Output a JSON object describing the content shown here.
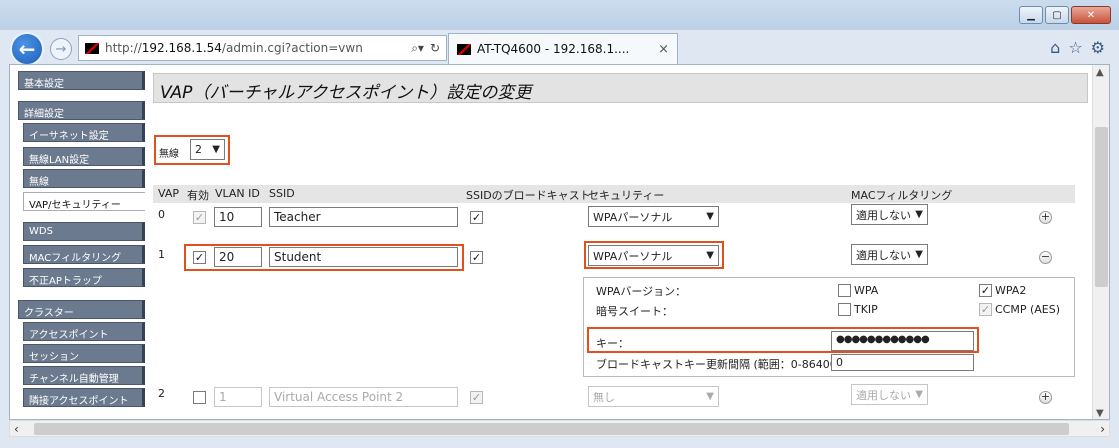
{
  "browser": {
    "address_prefix": "http://",
    "address_host": "192.168.1.54",
    "address_path": "/admin.cgi?action=vwn",
    "tab_title": "AT-TQ4600 - 192.168.1....",
    "tab_close": "×"
  },
  "sidebar": {
    "items": [
      {
        "label": "基本設定"
      },
      {
        "label": "詳細設定"
      },
      {
        "label": "イーサネット設定"
      },
      {
        "label": "無線LAN設定"
      },
      {
        "label": "無線"
      },
      {
        "label": "VAP/セキュリティー"
      },
      {
        "label": "WDS"
      },
      {
        "label": "MACフィルタリング"
      },
      {
        "label": "不正APトラップ"
      },
      {
        "label": "クラスター"
      },
      {
        "label": "アクセスポイント"
      },
      {
        "label": "セッション"
      },
      {
        "label": "チャンネル自動管理"
      },
      {
        "label": "隣接アクセスポイント"
      }
    ]
  },
  "main": {
    "title": "VAP（バーチャルアクセスポイント）設定の変更",
    "radio_label": "無線",
    "radio_value": "2",
    "headers": {
      "vap": "VAP",
      "enabled": "有効",
      "vlan": "VLAN ID",
      "ssid": "SSID",
      "broadcast": "SSIDのブロードキャスト",
      "security": "セキュリティー",
      "mac": "MACフィルタリング"
    },
    "rows": [
      {
        "vap": "0",
        "vlan": "10",
        "ssid": "Teacher",
        "security": "WPAパーソナル",
        "mac": "適用しない"
      },
      {
        "vap": "1",
        "vlan": "20",
        "ssid": "Student",
        "security": "WPAパーソナル",
        "mac": "適用しない"
      },
      {
        "vap": "2",
        "vlan": "1",
        "ssid": "Virtual Access Point 2",
        "security": "無し",
        "mac": "適用しない"
      }
    ],
    "wpa": {
      "version_label": "WPAバージョン：",
      "wpa": "WPA",
      "wpa2": "WPA2",
      "cipher_label": "暗号スイート：",
      "tkip": "TKIP",
      "ccmp": "CCMP (AES)",
      "key_label": "キー：",
      "key_value": "●●●●●●●●●●●●",
      "rekey_label": "ブロードキャストキー更新間隔 (範囲：0-86400)",
      "rekey_value": "0"
    }
  }
}
